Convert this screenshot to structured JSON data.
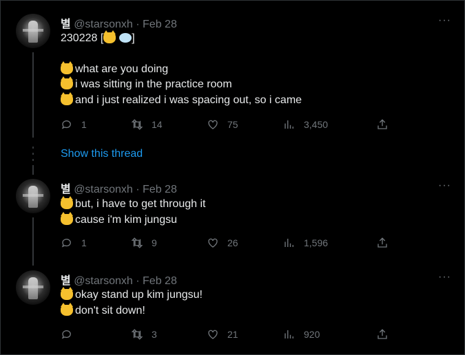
{
  "tweets": [
    {
      "name": "별",
      "handle": "@starsonxh",
      "separator": "·",
      "date": "Feb 28",
      "lines": [
        "230228 [",
        "]",
        "what are you doing",
        "i was sitting in the practice room",
        "and i just realized i was spacing out, so i came"
      ],
      "stats": {
        "replies": "1",
        "retweets": "14",
        "likes": "75",
        "views": "3,450"
      }
    },
    {
      "name": "별",
      "handle": "@starsonxh",
      "separator": "·",
      "date": "Feb 28",
      "lines": [
        "but, i have to get through it",
        "cause i'm kim jungsu"
      ],
      "stats": {
        "replies": "1",
        "retweets": "9",
        "likes": "26",
        "views": "1,596"
      }
    },
    {
      "name": "별",
      "handle": "@starsonxh",
      "separator": "·",
      "date": "Feb 28",
      "lines": [
        "okay stand up kim jungsu!",
        "don't sit down!"
      ],
      "stats": {
        "replies": "",
        "retweets": "3",
        "likes": "21",
        "views": "920"
      }
    }
  ],
  "show_thread": "Show this thread",
  "more_glyph": "···",
  "icons": [
    "reply-icon",
    "retweet-icon",
    "like-icon",
    "views-icon",
    "share-icon",
    "cat-emoji-icon",
    "thought-balloon-icon"
  ],
  "colors": {
    "link": "#1d9bf0",
    "muted": "#71767b",
    "text": "#e7e9ea",
    "background": "#000000"
  }
}
